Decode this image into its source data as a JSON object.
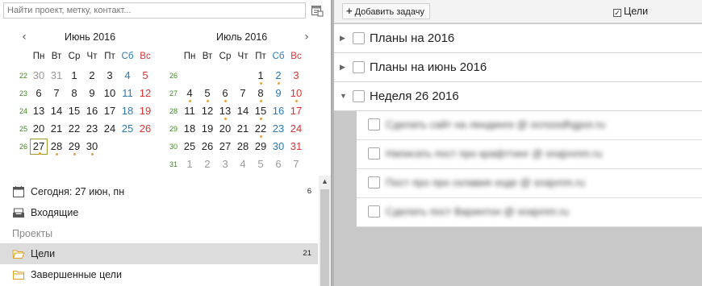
{
  "search": {
    "placeholder": "Найти проект, метку, контакт..."
  },
  "calendar": {
    "weekdays": [
      "Пн",
      "Вт",
      "Ср",
      "Чт",
      "Пт",
      "Сб",
      "Вс"
    ],
    "months": [
      {
        "title": "Июнь 2016",
        "weeks": [
          {
            "num": "22",
            "days": [
              [
                "30",
                "other"
              ],
              [
                "31",
                "other"
              ],
              [
                "1",
                ""
              ],
              [
                "2",
                ""
              ],
              [
                "3",
                ""
              ],
              [
                "4",
                "sat"
              ],
              [
                "5",
                "sun"
              ]
            ]
          },
          {
            "num": "23",
            "days": [
              [
                "6",
                ""
              ],
              [
                "7",
                ""
              ],
              [
                "8",
                ""
              ],
              [
                "9",
                ""
              ],
              [
                "10",
                ""
              ],
              [
                "11",
                "sat"
              ],
              [
                "12",
                "sun"
              ]
            ]
          },
          {
            "num": "24",
            "days": [
              [
                "13",
                ""
              ],
              [
                "14",
                ""
              ],
              [
                "15",
                ""
              ],
              [
                "16",
                ""
              ],
              [
                "17",
                ""
              ],
              [
                "18",
                "sat"
              ],
              [
                "19",
                "sun"
              ]
            ]
          },
          {
            "num": "25",
            "days": [
              [
                "20",
                ""
              ],
              [
                "21",
                ""
              ],
              [
                "22",
                ""
              ],
              [
                "23",
                ""
              ],
              [
                "24",
                ""
              ],
              [
                "25",
                "sat"
              ],
              [
                "26",
                "sun"
              ]
            ]
          },
          {
            "num": "26",
            "days": [
              [
                "27",
                "today dot"
              ],
              [
                "28",
                "dot"
              ],
              [
                "29",
                "dot"
              ],
              [
                "30",
                "dot"
              ]
            ]
          }
        ]
      },
      {
        "title": "Июль 2016",
        "weeks": [
          {
            "num": "26",
            "days": [
              [
                "",
                ""
              ],
              [
                "",
                ""
              ],
              [
                "",
                ""
              ],
              [
                "",
                ""
              ],
              [
                "1",
                "dot"
              ],
              [
                "2",
                "sat dot"
              ],
              [
                "3",
                "sun"
              ]
            ]
          },
          {
            "num": "27",
            "days": [
              [
                "4",
                "dot"
              ],
              [
                "5",
                "dot"
              ],
              [
                "6",
                "dot"
              ],
              [
                "7",
                ""
              ],
              [
                "8",
                "dot"
              ],
              [
                "9",
                "sat"
              ],
              [
                "10",
                "sun dot"
              ]
            ]
          },
          {
            "num": "28",
            "days": [
              [
                "11",
                ""
              ],
              [
                "12",
                ""
              ],
              [
                "13",
                "dot"
              ],
              [
                "14",
                ""
              ],
              [
                "15",
                "dot"
              ],
              [
                "16",
                "sat"
              ],
              [
                "17",
                "sun"
              ]
            ]
          },
          {
            "num": "29",
            "days": [
              [
                "18",
                ""
              ],
              [
                "19",
                ""
              ],
              [
                "20",
                ""
              ],
              [
                "21",
                ""
              ],
              [
                "22",
                "dot"
              ],
              [
                "23",
                "sat"
              ],
              [
                "24",
                "sun"
              ]
            ]
          },
          {
            "num": "30",
            "days": [
              [
                "25",
                ""
              ],
              [
                "26",
                ""
              ],
              [
                "27",
                ""
              ],
              [
                "28",
                ""
              ],
              [
                "29",
                ""
              ],
              [
                "30",
                "sat"
              ],
              [
                "31",
                "sun"
              ]
            ]
          },
          {
            "num": "31",
            "days": [
              [
                "1",
                "other"
              ],
              [
                "2",
                "other"
              ],
              [
                "3",
                "other"
              ],
              [
                "4",
                "other"
              ],
              [
                "5",
                "other"
              ],
              [
                "6",
                "other"
              ],
              [
                "7",
                "other"
              ]
            ]
          }
        ]
      }
    ]
  },
  "nav": {
    "today_label": "Сегодня: 27 июн, пн",
    "today_count": "6",
    "inbox_label": "Входящие",
    "projects_header": "Проекты",
    "goals_label": "Цели",
    "goals_count": "21",
    "completed_label": "Завершенные цели"
  },
  "toolbar": {
    "add_task_label": "Добавить задачу",
    "goals_toggle_label": "Цели",
    "goals_toggle_checked": true
  },
  "groups": [
    {
      "label": "Планы на 2016",
      "expanded": false
    },
    {
      "label": "Планы на июнь 2016",
      "expanded": false
    },
    {
      "label": "Неделя 26 2016",
      "expanded": true
    }
  ],
  "tasks": [
    {
      "label": "Сделать сайт на лендинге @ ocrsssdhgpor.ru"
    },
    {
      "label": "Написать пост про крафттинг @ snajvvnm.ru"
    },
    {
      "label": "Пост про про склавия ходе @ snajvnm.ru"
    },
    {
      "label": "Сделать пост Варинтон @ snajvnm.ru"
    }
  ],
  "colors": {
    "accent_week": "#3e8a1e",
    "saturday": "#2a7ab8",
    "sunday": "#dd3333",
    "dot": "#e8a33a"
  }
}
